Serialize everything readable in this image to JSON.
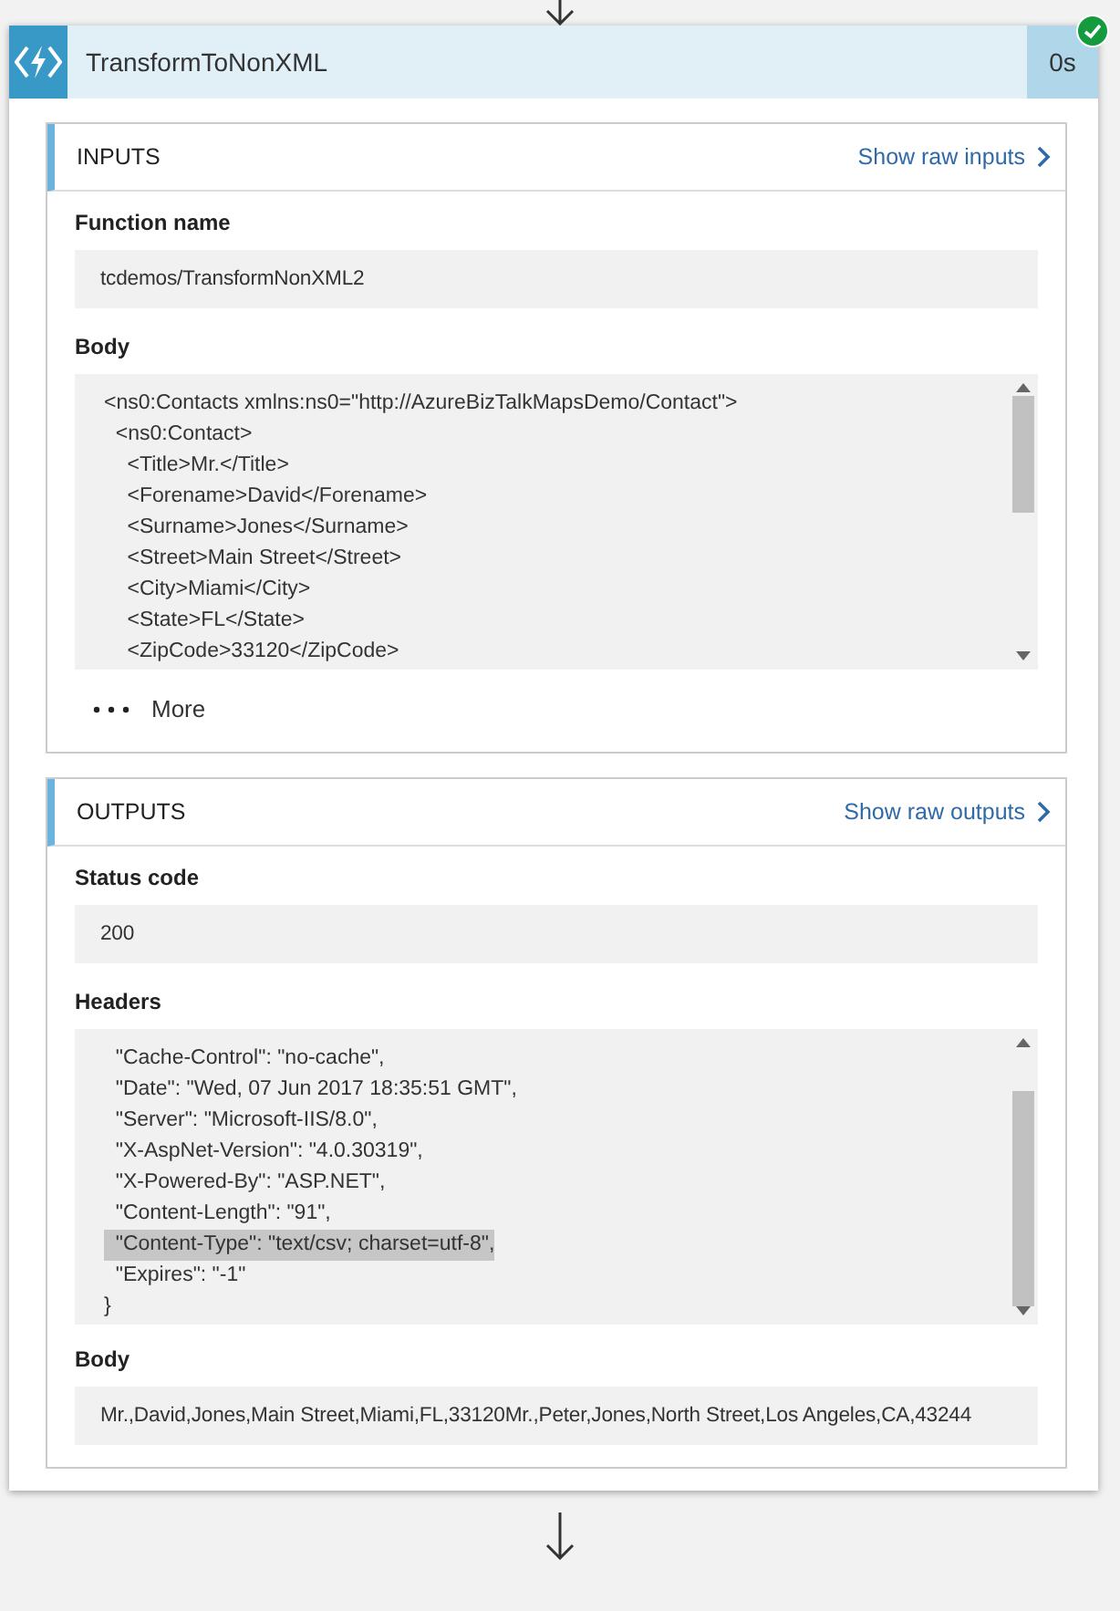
{
  "action": {
    "title": "TransformToNonXML",
    "duration": "0s",
    "succeeded": true
  },
  "sections": [
    {
      "title": "INPUTS",
      "raw_link": "Show raw inputs",
      "fields": [
        {
          "kind": "value",
          "label": "Function name",
          "value": "tcdemos/TransformNonXML2"
        },
        {
          "kind": "code",
          "label": "Body",
          "lines": [
            {
              "text": "<ns0:Contacts xmlns:ns0=\"http://AzureBizTalkMapsDemo/Contact\">",
              "highlighted": false
            },
            {
              "text": "  <ns0:Contact>",
              "highlighted": false
            },
            {
              "text": "    <Title>Mr.</Title>",
              "highlighted": false
            },
            {
              "text": "    <Forename>David</Forename>",
              "highlighted": false
            },
            {
              "text": "    <Surname>Jones</Surname>",
              "highlighted": false
            },
            {
              "text": "    <Street>Main Street</Street>",
              "highlighted": false
            },
            {
              "text": "    <City>Miami</City>",
              "highlighted": false
            },
            {
              "text": "    <State>FL</State>",
              "highlighted": false
            },
            {
              "text": "    <ZipCode>33120</ZipCode>",
              "highlighted": false
            }
          ]
        }
      ],
      "more": "More"
    },
    {
      "title": "OUTPUTS",
      "raw_link": "Show raw outputs",
      "fields": [
        {
          "kind": "value",
          "label": "Status code",
          "value": "200"
        },
        {
          "kind": "code",
          "label": "Headers",
          "lines": [
            {
              "text": "  \"Cache-Control\": \"no-cache\",",
              "highlighted": false
            },
            {
              "text": "  \"Date\": \"Wed, 07 Jun 2017 18:35:51 GMT\",",
              "highlighted": false
            },
            {
              "text": "  \"Server\": \"Microsoft-IIS/8.0\",",
              "highlighted": false
            },
            {
              "text": "  \"X-AspNet-Version\": \"4.0.30319\",",
              "highlighted": false
            },
            {
              "text": "  \"X-Powered-By\": \"ASP.NET\",",
              "highlighted": false
            },
            {
              "text": "  \"Content-Length\": \"91\",",
              "highlighted": false
            },
            {
              "text": "  \"Content-Type\": \"text/csv; charset=utf-8\",",
              "highlighted": true
            },
            {
              "text": "  \"Expires\": \"-1\"",
              "highlighted": false
            },
            {
              "text": "}",
              "highlighted": false
            }
          ]
        },
        {
          "kind": "value",
          "label": "Body",
          "value": "Mr.,David,Jones,Main Street,Miami,FL,33120Mr.,Peter,Jones,North Street,Los Angeles,CA,43244"
        }
      ]
    }
  ]
}
